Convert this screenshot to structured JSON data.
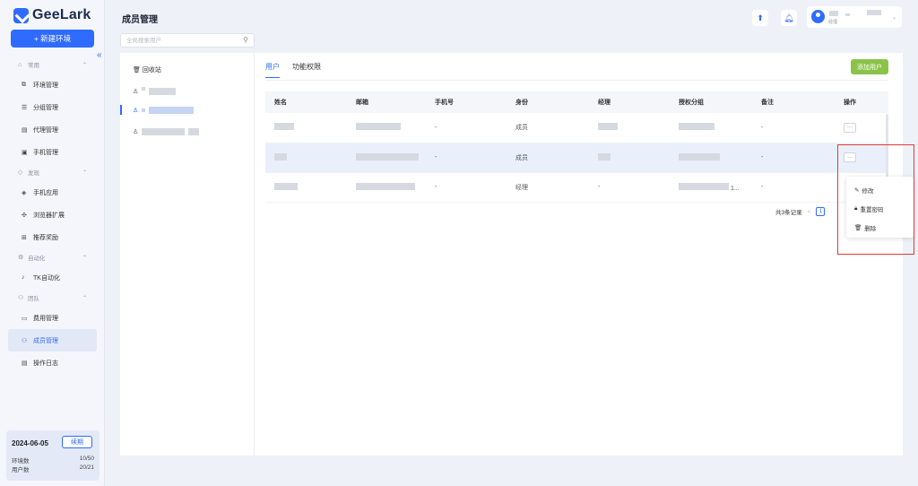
{
  "app": {
    "name": "GeeLark"
  },
  "sidebar": {
    "new_env_label": "+ 新建环境",
    "collapse_label": "«",
    "groups": [
      {
        "label": "常用",
        "items": [
          "环境管理",
          "分组管理",
          "代理管理",
          "手机管理"
        ]
      },
      {
        "label": "发现",
        "items": [
          "手机应用",
          "浏览器扩展",
          "推荐奖励"
        ]
      },
      {
        "label": "自动化",
        "items": [
          "TK自动化"
        ]
      },
      {
        "label": "团队",
        "items": [
          "费用管理",
          "成员管理",
          "操作日志"
        ]
      }
    ],
    "active_item": "成员管理",
    "plan": {
      "date": "2024-06-05",
      "renew_label": "续期",
      "env_count_label": "环境数",
      "env_count_value": "10/50",
      "user_count_label": "用户数",
      "user_count_value": "20/21"
    }
  },
  "header": {
    "title": "成员管理",
    "user_role": "经理"
  },
  "left_panel": {
    "search_placeholder": "全局搜索用户",
    "recycle_label": "回收站"
  },
  "main": {
    "tabs": [
      "用户",
      "功能权限"
    ],
    "active_tab": "用户",
    "add_user_label": "添加用户",
    "table": {
      "columns": [
        "姓名",
        "邮箱",
        "手机号",
        "身份",
        "经理",
        "授权分组",
        "备注",
        "操作"
      ],
      "rows": [
        {
          "phone": "-",
          "role": "成员",
          "remark": "-",
          "more": "···"
        },
        {
          "phone": "-",
          "role": "成员",
          "remark": "-",
          "more": "···"
        },
        {
          "phone": "-",
          "role": "经理",
          "manager": "-",
          "group_suffix": "1...",
          "remark": "-"
        }
      ]
    },
    "pager": {
      "total_text": "共3条记录",
      "prev": "<",
      "page": "1"
    },
    "dropdown": {
      "items": [
        "修改",
        "重置密码",
        "删除"
      ]
    }
  }
}
